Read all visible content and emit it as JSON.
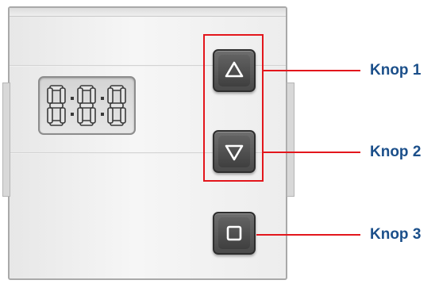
{
  "labels": {
    "button1": "Knop 1",
    "button2": "Knop 2",
    "button3": "Knop 3"
  },
  "icons": {
    "button1": "triangle-up-icon",
    "button2": "triangle-down-icon",
    "button3": "square-icon",
    "display": "seven-segment-display"
  },
  "colors": {
    "callout": "#e3161c",
    "label_text": "#1b4f8a",
    "button": "#4a4a4a",
    "panel": "#efefef"
  }
}
